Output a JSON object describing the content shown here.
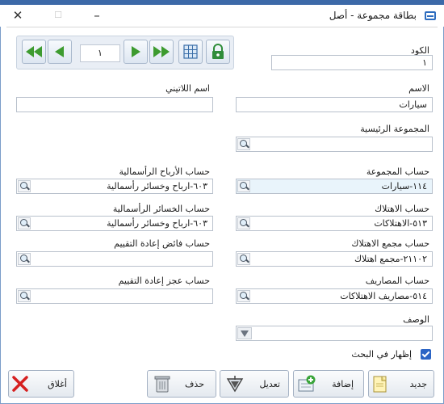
{
  "window": {
    "title": "بطاقة مجموعة - أصل"
  },
  "nav": {
    "page": "١"
  },
  "fields": {
    "code_label": "الكود",
    "code_value": "١",
    "name_label": "الاسم",
    "name_value": "سيارات",
    "latin_name_label": "اسم اللاتيني",
    "latin_name_value": "",
    "parent_group_label": "المجموعة الرئيسية",
    "parent_group_value": "",
    "group_account_label": "حساب المجموعة",
    "group_account_value": "١١٤-سيارات",
    "depreciation_account_label": "حساب الاهتلاك",
    "depreciation_account_value": "٥١٣-الاهتلاكات",
    "accum_depreciation_label": "حساب مجمع الاهتلاك",
    "accum_depreciation_value": "٢١١٠٢-مجمع اهتلاك",
    "expenses_account_label": "حساب المصاريف",
    "expenses_account_value": "٥١٤-مصاريف الاهتلاكات",
    "capital_gains_label": "حساب الأرباح الرأسمالية",
    "capital_gains_value": "٦٠٣-ارباح وخسائر رأسمالية",
    "capital_losses_label": "حساب الخسائر الرأسمالية",
    "capital_losses_value": "٦٠٣-ارباح وخسائر رأسمالية",
    "revaluation_surplus_label": "حساب فائض إعادة التقييم",
    "revaluation_surplus_value": "",
    "revaluation_deficit_label": "حساب عجز إعادة التقييم",
    "revaluation_deficit_value": "",
    "description_label": "الوصف",
    "description_value": "",
    "show_in_search_label": "إظهار في البحث",
    "show_in_search_checked": true
  },
  "buttons": {
    "new": "جديد",
    "add": "إضافة",
    "edit": "تعديل",
    "delete": "حذف",
    "close": "أغلاق"
  },
  "colors": {
    "title_accent": "#2e6dbf",
    "nav_arrow_green": "#3d9b2f",
    "close_red": "#d62020",
    "lock_green": "#2f8d3a",
    "checkbox_blue": "#2b64c5"
  }
}
